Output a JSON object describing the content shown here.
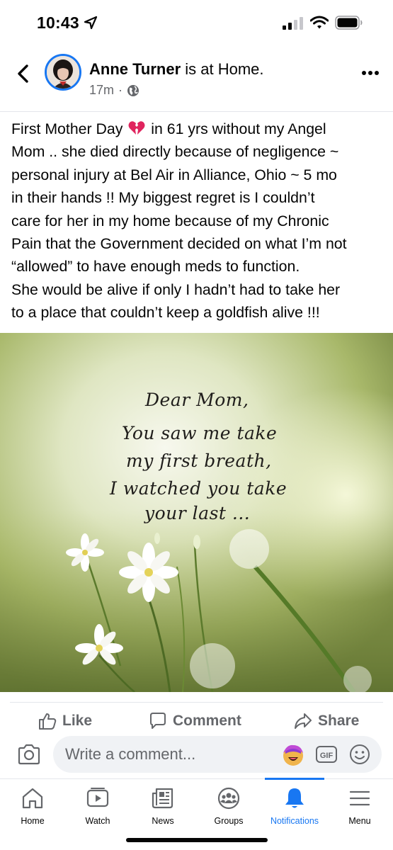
{
  "status_bar": {
    "time": "10:43"
  },
  "post": {
    "author": "Anne Turner",
    "author_context": " is at Home.",
    "time_ago": "17m",
    "meta_separator": "·",
    "text_lines": [
      [
        "First Mother Day ",
        " in 61 yrs without my Angel"
      ],
      "Mom .. she died directly because of negligence ~",
      "personal injury at Bel Air in Alliance, Ohio  ~ 5 mo",
      "in their hands !! My biggest regret is I couldn’t",
      "care for her in my home because of my Chronic",
      "Pain that the Government decided on what I’m not",
      "“allowed” to have enough meds to function.",
      "She would be alive if only I hadn’t had to take her",
      "to a place that couldn’t keep a goldfish alive !!!"
    ],
    "image_quote": [
      "Dear Mom,",
      "You saw me take",
      "my first breath,",
      "I watched you take",
      "your last ..."
    ]
  },
  "actions": {
    "like": "Like",
    "comment": "Comment",
    "share": "Share"
  },
  "comment_bar": {
    "placeholder": "Write a comment...",
    "gif_label": "GIF"
  },
  "nav": {
    "items": [
      {
        "label": "Home",
        "icon": "home-icon"
      },
      {
        "label": "Watch",
        "icon": "watch-icon"
      },
      {
        "label": "News",
        "icon": "news-icon"
      },
      {
        "label": "Groups",
        "icon": "groups-icon"
      },
      {
        "label": "Notifications",
        "icon": "bell-icon",
        "active": true
      },
      {
        "label": "Menu",
        "icon": "menu-icon"
      }
    ]
  },
  "colors": {
    "accent": "#1877f2",
    "secondary_text": "#65676b",
    "input_bg": "#f0f2f5"
  }
}
